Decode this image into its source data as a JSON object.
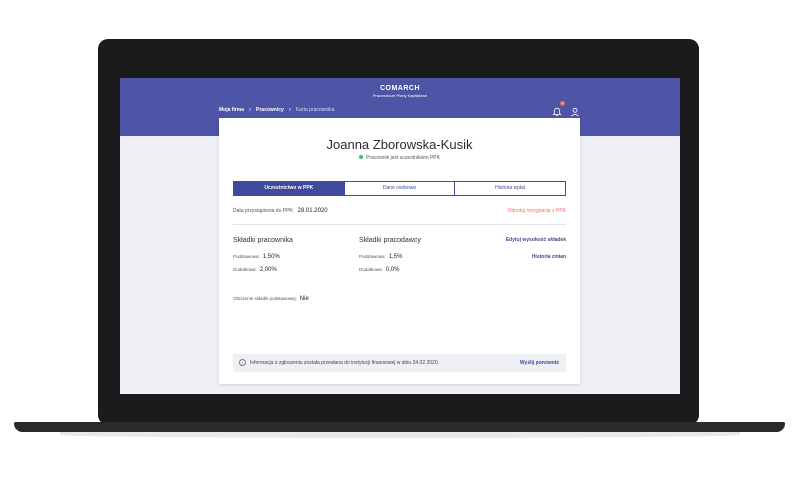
{
  "header": {
    "brand": "COMARCH",
    "subtitle": "Pracownicze Plany Kapitałowe",
    "breadcrumb": {
      "item1": "Moja firma",
      "item2": "Pracownicy",
      "current": "Karta pracownika"
    },
    "notification_count": "1"
  },
  "employee": {
    "name": "Joanna Zborowska-Kusik",
    "status": "Pracownik jest uczestnikiem PPK"
  },
  "tabs": [
    "Uczestnictwo w PPK",
    "Dane osobowe",
    "Historia wpłat"
  ],
  "participation": {
    "join_label": "Data przystąpienia do PPK:",
    "join_date": "28.01.2020",
    "resign_link": "Odnotuj rezygnację z PPK"
  },
  "employee_contrib": {
    "title": "Składki pracownika",
    "basic_label": "Podstawowa:",
    "basic_value": "1,50%",
    "extra_label": "Dodatkowa:",
    "extra_value": "2,00%"
  },
  "employer_contrib": {
    "title": "Składki pracodawcy",
    "basic_label": "Podstawowa:",
    "basic_value": "1,5%",
    "extra_label": "Dodatkowa:",
    "extra_value": "0,0%"
  },
  "actions": {
    "edit_rates": "Edytuj wysokość składek",
    "history": "Historia zmian"
  },
  "reduction": {
    "label": "Obniżenie składki podstawowej:",
    "value": "Nie"
  },
  "info": {
    "icon": "i",
    "text": "Informacja o zgłoszeniu została przesłana do instytucji finansowej w dniu 24.02.2020.",
    "resend": "Wyślij ponownie"
  },
  "colors": {
    "primary": "#4e55a7",
    "accent_dark": "#3f4a9d",
    "danger": "#ef6d63",
    "success": "#32c36c"
  }
}
